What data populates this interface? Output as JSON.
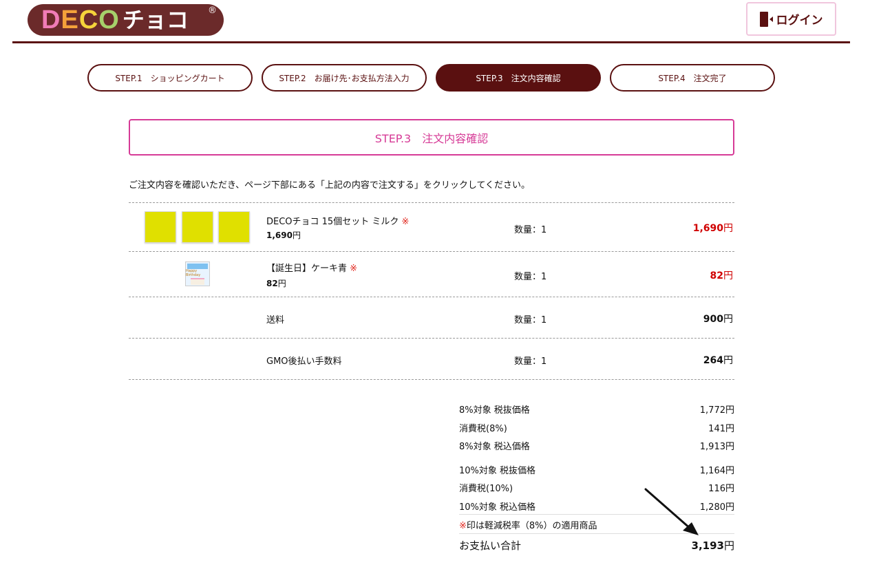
{
  "header": {
    "logo_letters": [
      "D",
      "E",
      "C",
      "O"
    ],
    "logo_letter_colors": [
      "#f07cb6",
      "#f4a13a",
      "#f5d33b",
      "#a6d06a"
    ],
    "logo_suffix": "チョコ",
    "logo_reg": "®",
    "login_label": "ログイン"
  },
  "steps": [
    {
      "label": "STEP.1　ショッピングカート"
    },
    {
      "label": "STEP.2　お届け先･お支払方法入力"
    },
    {
      "label": "STEP.3　注文内容確認"
    },
    {
      "label": "STEP.4　注文完了"
    }
  ],
  "page_title": "STEP.3　注文内容確認",
  "intro": "ご注文内容を確認いただき、ページ下部にある「上記の内容で注文する」をクリックしてください。",
  "items": [
    {
      "name": "DECOチョコ 15個セット ミルク",
      "mark": "※",
      "unit_num": "1,690",
      "unit_yen": "円",
      "qty": "数量：1",
      "price_num": "1,690",
      "price_yen": "円"
    },
    {
      "name": "【誕生日】ケーキ青",
      "mark": "※",
      "unit_num": "82",
      "unit_yen": "円",
      "qty": "数量：1",
      "price_num": "82",
      "price_yen": "円",
      "thumb_text": "Happy Birthday"
    },
    {
      "name": "送料",
      "qty": "数量：1",
      "price_num": "900",
      "price_yen": "円"
    },
    {
      "name": "GMO後払い手数料",
      "qty": "数量：1",
      "price_num": "264",
      "price_yen": "円"
    }
  ],
  "summary": [
    {
      "label": "8%対象 税抜価格",
      "value": "1,772円"
    },
    {
      "label": "消費税(8%)",
      "value": "141円"
    },
    {
      "label": "8%対象 税込価格",
      "value": "1,913円"
    },
    {
      "label": "10%対象 税抜価格",
      "value": "1,164円"
    },
    {
      "label": "消費税(10%)",
      "value": "116円"
    },
    {
      "label": "10%対象 税込価格",
      "value": "1,280円"
    }
  ],
  "note_mark": "※",
  "note": "印は軽減税率（8%）の適用商品",
  "total": {
    "label": "お支払い合計",
    "num": "3,193",
    "yen": "円"
  }
}
